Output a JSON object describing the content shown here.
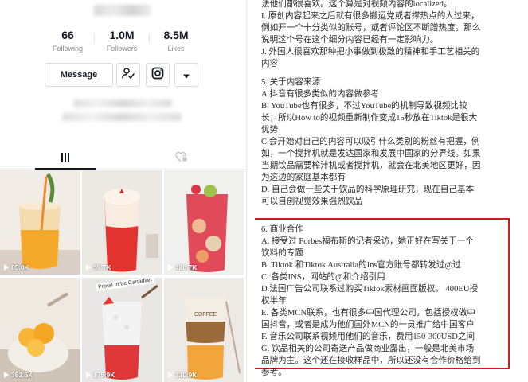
{
  "profile": {
    "stats": [
      {
        "value": "66",
        "label": "Following"
      },
      {
        "value": "1.0M",
        "label": "Followers"
      },
      {
        "value": "8.5M",
        "label": "Likes"
      }
    ],
    "message_button": "Message",
    "icons": {
      "follow": "user-follow-icon",
      "instagram": "instagram-icon",
      "more": "caret-down-icon",
      "videos_tab": "grid-icon",
      "liked_tab": "heart-lock-icon"
    }
  },
  "videos": [
    {
      "views": "85.0K"
    },
    {
      "views": "59.7K"
    },
    {
      "views": "420.7K"
    },
    {
      "views": "362.6K"
    },
    {
      "views": "175.9K"
    },
    {
      "views": "320.9K"
    }
  ],
  "video_overlay_text": [
    "Proud to be Canadian",
    "COFFEE"
  ],
  "article": {
    "top_lines": [
      "法他们都很喜欢。这个算是对视频内容的localized。",
      "I. 原创内容起来之后就有很多搬运党或者撑热点的人过来，",
      "例如开一个十分类似的账号，或者评论区不断蹭热度。那么",
      "说明这个号在这个细分内容已经有一定影响力。",
      "J. 外国人很喜欢那种把小事做到极致的精神和手工艺相关的",
      "内容"
    ],
    "section5_lines": [
      "5. 关于内容来源",
      "A.抖音有很多类似的内容做参考",
      "B. YouTube也有很多，不过YouTube的机制导致视频比较",
      "长，所以How to的视频重新制作变成15秒放在Tiktok是很大",
      "优势",
      "C.会开始对自己的内容可以吸引什么类别的粉丝有把握，例",
      "如，一个搅拌机就是发达国家和发展中国家的分界线。如果",
      "当期饮品需要榨汁机或者搅拌机，就会在北美地区更好，因",
      "为这边的家庭基本都有",
      "D. 自己会做一些关于饮品的科学原理研究，现在自己基本",
      "可以自创视觉效果强烈饮品"
    ],
    "section6_lines": [
      "6. 商业合作",
      "A. 接受过 Forbes福布斯的记者采访，她正好在写关于一个",
      "饮料的专题",
      "B. Tiktok 和Tiktok Australia的Ins官方账号都转发过@过",
      "C. 各类INS，网站的@和介绍引用",
      "D.法国广告公司联系过购买Tiktok素材画面版权。 400EU授",
      "权半年",
      "E. 各类MCN联系，也有很多中国代理公司，包括授权做中",
      "国抖音，或者是成为他们国外MCN的一员推广给中国客户",
      "F. 音乐公司联系视频用他们的音乐，费用150-300USD之间",
      "G. 饮品相关的公司寄送产品做商业露出，一般是北美市场",
      "品牌为主。这个还在接收样品中，所以还没有合作价格给到",
      "参考。"
    ]
  },
  "colors": {
    "highlight_border": "#d11d1d",
    "text": "#2b2b2b",
    "muted": "#8a8b91"
  }
}
